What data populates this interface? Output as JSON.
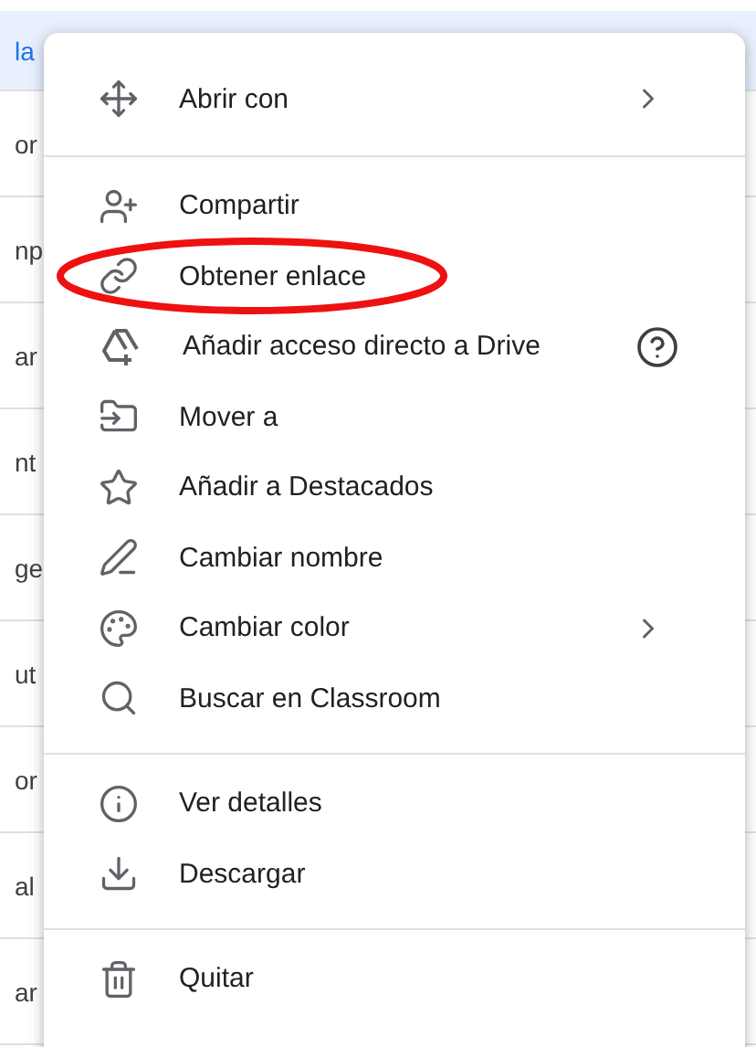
{
  "file_list": {
    "rows": [
      {
        "name": "la",
        "selected": true
      },
      {
        "name": "or",
        "selected": false
      },
      {
        "name": "np",
        "selected": false
      },
      {
        "name": "ar",
        "selected": false
      },
      {
        "name": "nt",
        "selected": false
      },
      {
        "name": "ge",
        "selected": false
      },
      {
        "name": "ut",
        "selected": false
      },
      {
        "name": "or",
        "selected": false
      },
      {
        "name": "al",
        "selected": false
      },
      {
        "name": "ar",
        "selected": false
      }
    ]
  },
  "context_menu": {
    "groups": [
      {
        "items": [
          {
            "label": "Abrir con",
            "submenu": true,
            "help": false,
            "highlighted": false
          }
        ]
      },
      {
        "items": [
          {
            "label": "Compartir",
            "submenu": false,
            "help": false,
            "highlighted": false
          },
          {
            "label": "Obtener enlace",
            "submenu": false,
            "help": false,
            "highlighted": true
          },
          {
            "label": "Añadir acceso directo a Drive",
            "submenu": false,
            "help": true,
            "highlighted": false
          },
          {
            "label": "Mover a",
            "submenu": false,
            "help": false,
            "highlighted": false
          },
          {
            "label": "Añadir a Destacados",
            "submenu": false,
            "help": false,
            "highlighted": false
          },
          {
            "label": "Cambiar nombre",
            "submenu": false,
            "help": false,
            "highlighted": false
          },
          {
            "label": "Cambiar color",
            "submenu": true,
            "help": false,
            "highlighted": false
          },
          {
            "label": "Buscar en Classroom",
            "submenu": false,
            "help": false,
            "highlighted": false
          }
        ]
      },
      {
        "items": [
          {
            "label": "Ver detalles",
            "submenu": false,
            "help": false,
            "highlighted": false
          },
          {
            "label": "Descargar",
            "submenu": false,
            "help": false,
            "highlighted": false
          }
        ]
      },
      {
        "items": [
          {
            "label": "Quitar",
            "submenu": false,
            "help": false,
            "highlighted": false
          }
        ]
      }
    ]
  }
}
